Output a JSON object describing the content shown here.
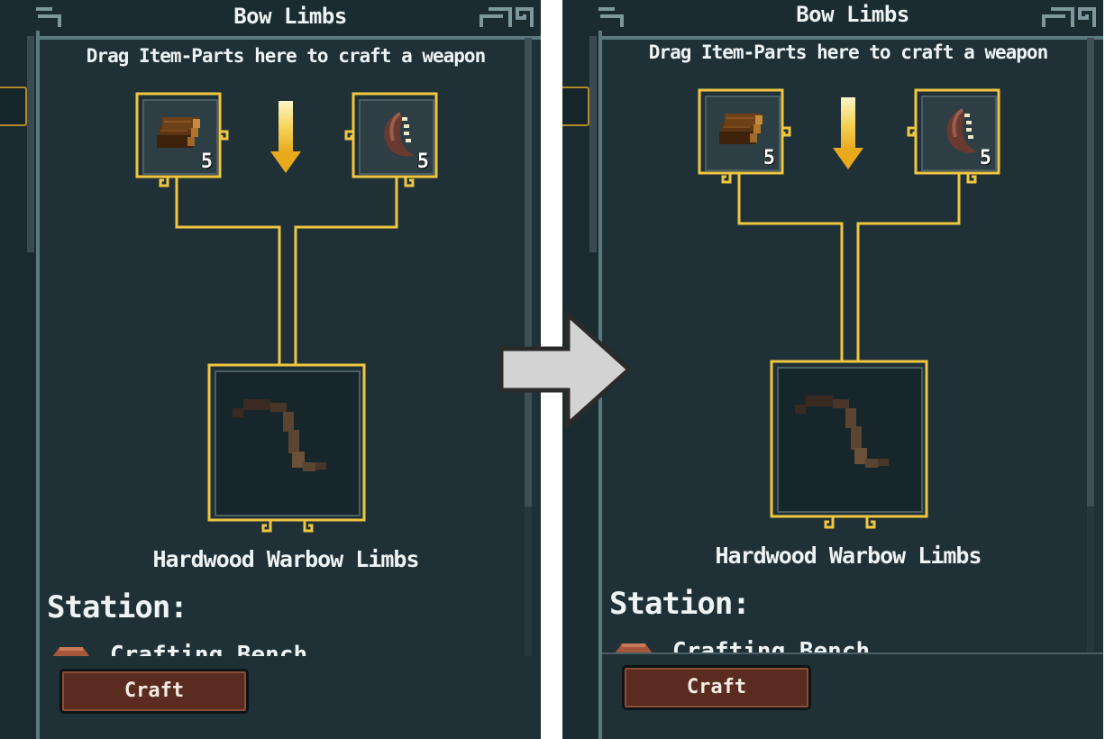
{
  "panels": [
    {
      "title": "Bow Limbs",
      "hint": "Drag Item-Parts here to craft a weapon",
      "ingredients": [
        {
          "icon": "hardwood-log-icon",
          "quantity": "5"
        },
        {
          "icon": "curved-limb-part-icon",
          "quantity": "5"
        }
      ],
      "result": {
        "icon": "warbow-limbs-icon",
        "name": "Hardwood Warbow Limbs"
      },
      "station_label": "Station:",
      "station_name": "Crafting Bench",
      "craft_label": "Craft"
    },
    {
      "title": "Bow Limbs",
      "hint": "Drag Item-Parts here to craft a weapon",
      "ingredients": [
        {
          "icon": "hardwood-log-icon",
          "quantity": "5"
        },
        {
          "icon": "curved-limb-part-icon",
          "quantity": "5"
        }
      ],
      "result": {
        "icon": "warbow-limbs-icon",
        "name": "Hardwood Warbow Limbs"
      },
      "station_label": "Station:",
      "station_name": "Crafting Bench",
      "craft_label": "Craft"
    }
  ],
  "colors": {
    "panel_bg": "#1f3137",
    "gold_frame": "#f0c640",
    "border": "#5b7a80",
    "button_bg": "#5a2c1f"
  }
}
